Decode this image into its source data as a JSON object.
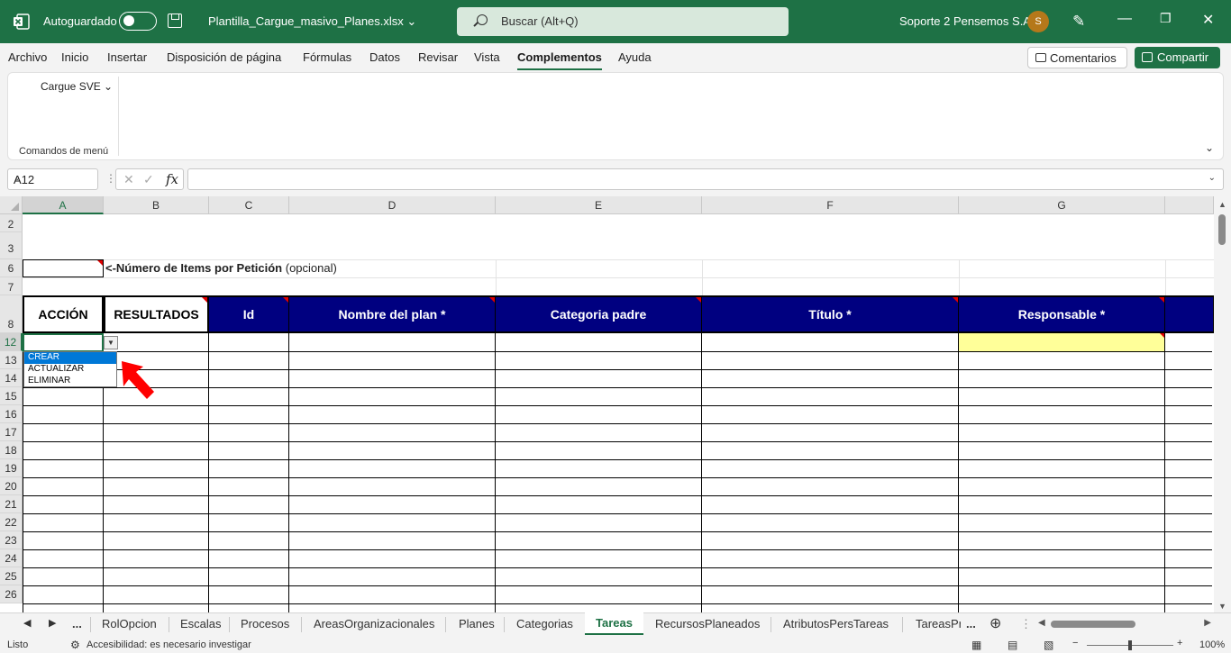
{
  "titlebar": {
    "autosave_label": "Autoguardado",
    "filename": "Plantilla_Cargue_masivo_Planes.xlsx",
    "search_placeholder": "Buscar (Alt+Q)",
    "user_name": "Soporte 2 Pensemos S.A.",
    "avatar_initial": "S"
  },
  "menu": [
    "Archivo",
    "Inicio",
    "Insertar",
    "Disposición de página",
    "Fórmulas",
    "Datos",
    "Revisar",
    "Vista",
    "Complementos",
    "Ayuda"
  ],
  "menu_active": "Complementos",
  "buttons": {
    "comments": "Comentarios",
    "share": "Compartir"
  },
  "ribbon": {
    "dropdown_label": "Cargue SVE",
    "group_label": "Comandos de menú"
  },
  "formula_bar": {
    "name_box": "A12",
    "fx": "fx",
    "value": ""
  },
  "columns": [
    "A",
    "B",
    "C",
    "D",
    "E",
    "F",
    "G"
  ],
  "rows": [
    "2",
    "3",
    "6",
    "7",
    "8",
    "12",
    "13",
    "14",
    "15",
    "16",
    "17",
    "18",
    "19",
    "20",
    "21",
    "22",
    "23",
    "24",
    "25",
    "26"
  ],
  "sheet": {
    "row6_text_bold": "<-Número de Items por Petición",
    "row6_text_normal": " (opcional)",
    "headers": [
      "ACCIÓN",
      "RESULTADOS",
      "Id",
      "Nombre del plan *",
      "Categoria padre",
      "Título *",
      "Responsable *"
    ]
  },
  "dropdown_options": [
    "CREAR",
    "ACTUALIZAR",
    "ELIMINAR"
  ],
  "sheet_tabs": [
    "RolOpcion",
    "Escalas",
    "Procesos",
    "AreasOrganizacionales",
    "Planes",
    "Categorias",
    "Tareas",
    "RecursosPlaneados",
    "AtributosPersTareas",
    "TareasPr"
  ],
  "active_tab": "Tareas",
  "status": {
    "ready": "Listo",
    "accessibility": "Accesibilidad: es necesario investigar",
    "zoom": "100%"
  },
  "colors": {
    "excel_green": "#1e7145",
    "header_blue": "#000080",
    "highlight_yellow": "#ffff99"
  }
}
